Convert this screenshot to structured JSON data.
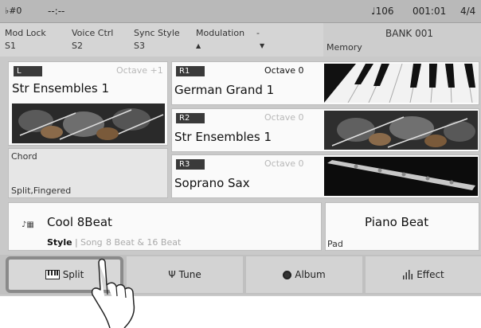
{
  "status": {
    "transpose": "♭#0",
    "time": "--:--",
    "tempo_icon": "quarter-note",
    "tempo": "♩106",
    "measure": "001:01",
    "signature": "4/4"
  },
  "info": {
    "mod_lock": {
      "label": "Mod Lock",
      "value": "S1"
    },
    "voice_ctrl": {
      "label": "Voice Ctrl",
      "value": "S2"
    },
    "sync_style": {
      "label": "Sync Style",
      "value": "S3"
    },
    "modulation": {
      "label": "Modulation",
      "value": "-",
      "up": "▲",
      "down": "▼"
    },
    "memory": {
      "label": "Memory",
      "bank": "BANK 001"
    }
  },
  "voices": {
    "left": {
      "tag": "L",
      "octave": "Octave +1",
      "name": "Str Ensembles 1"
    },
    "r1": {
      "tag": "R1",
      "octave": "Octave 0",
      "name": "German Grand 1"
    },
    "r2": {
      "tag": "R2",
      "octave": "Octave 0",
      "name": "Str Ensembles 1"
    },
    "r3": {
      "tag": "R3",
      "octave": "Octave 0",
      "name": "Soprano Sax"
    }
  },
  "chord": {
    "title": "Chord",
    "mode": "Split,Fingered"
  },
  "style": {
    "name": "Cool 8Beat",
    "label": "Style",
    "separator": "|",
    "song": "Song",
    "category": "8 Beat & 16 Beat"
  },
  "pad": {
    "name": "Piano Beat",
    "label": "Pad"
  },
  "tabs": [
    {
      "label": "Split",
      "icon": "keyboard-icon",
      "selected": true
    },
    {
      "label": "Tune",
      "icon": "tuning-fork-icon",
      "selected": false
    },
    {
      "label": "Album",
      "icon": "disc-icon",
      "selected": false
    },
    {
      "label": "Effect",
      "icon": "level-bars-icon",
      "selected": false
    }
  ]
}
